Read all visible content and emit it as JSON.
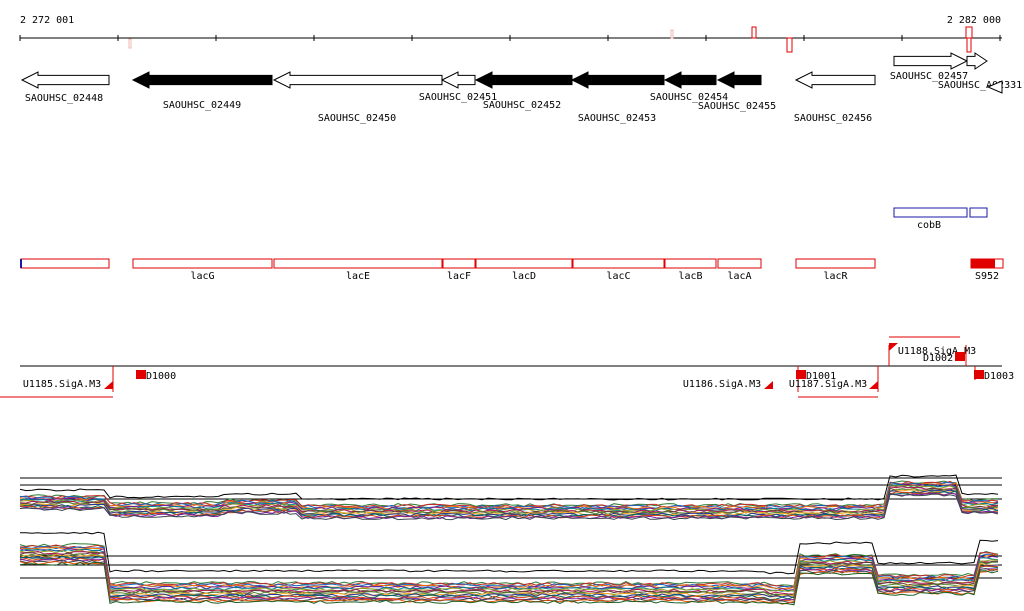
{
  "ruler": {
    "start_label": "2 272 001",
    "end_label": "2 282 000"
  },
  "colors": {
    "line": "#000000",
    "region": "#e00000",
    "cob": "#1a1aa6",
    "trace_palette": [
      "#2e7d32",
      "#c62828",
      "#1565c0",
      "#ef6c00",
      "#6a1b9a",
      "#00838f",
      "#9e9d24",
      "#ad1457",
      "#5d4037",
      "#558b2f",
      "#f9a825",
      "#283593",
      "#00695c",
      "#d84315",
      "#7b1fa2",
      "#37474f",
      "#e65100",
      "#1b5e20"
    ]
  },
  "genes": [
    {
      "label": "SAOUHSC_02448",
      "filled": false
    },
    {
      "label": "SAOUHSC_02449",
      "filled": true
    },
    {
      "label": "SAOUHSC_02450",
      "filled": false
    },
    {
      "label": "SAOUHSC_02451",
      "filled": false
    },
    {
      "label": "SAOUHSC_02452",
      "filled": true
    },
    {
      "label": "SAOUHSC_02453",
      "filled": true
    },
    {
      "label": "SAOUHSC_02454",
      "filled": true
    },
    {
      "label": "SAOUHSC_02455",
      "filled": true
    },
    {
      "label": "SAOUHSC_02456",
      "filled": false
    },
    {
      "label": "SAOUHSC_02457",
      "filled": false
    },
    {
      "label": "SAOUHSC_A02331",
      "filled": false
    }
  ],
  "cob": {
    "label": "cobB"
  },
  "regions": [
    {
      "label": ""
    },
    {
      "label": "lacG"
    },
    {
      "label": "lacE"
    },
    {
      "label": "lacF"
    },
    {
      "label": "lacD"
    },
    {
      "label": "lacC"
    },
    {
      "label": "lacB"
    },
    {
      "label": "lacA"
    },
    {
      "label": "lacR"
    },
    {
      "label": "S952"
    }
  ],
  "transcripts": [
    {
      "label": "U1185.SigA.M3"
    },
    {
      "label": "U1186.SigA.M3"
    },
    {
      "label": "U1187.SigA.M3"
    },
    {
      "label": "U1188.SigA.M3"
    }
  ],
  "sites": [
    {
      "label": "D1000"
    },
    {
      "label": "D1001"
    },
    {
      "label": "D1002"
    },
    {
      "label": "D1003"
    }
  ]
}
